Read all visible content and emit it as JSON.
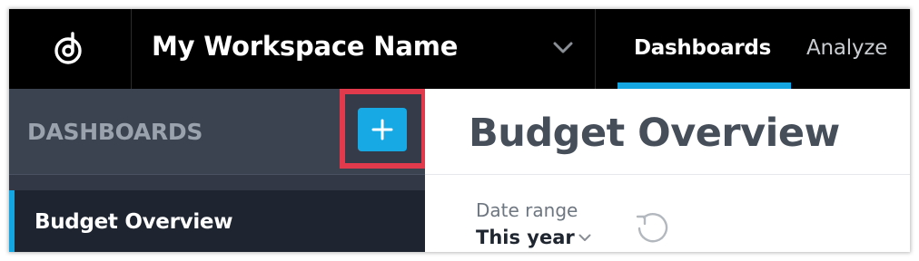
{
  "topbar": {
    "logo_icon": "product-logo-icon",
    "workspace_name": "My Workspace Name",
    "workspace_chevron_icon": "chevron-down-icon",
    "tabs": [
      {
        "label": "Dashboards",
        "active": true
      },
      {
        "label": "Analyze",
        "active": false
      }
    ]
  },
  "sidebar": {
    "title": "DASHBOARDS",
    "add_button_icon": "plus-icon",
    "items": [
      {
        "label": "Budget Overview",
        "active": true
      }
    ]
  },
  "main": {
    "title": "Budget Overview",
    "filters": {
      "date_range_label": "Date range",
      "date_range_value": "This year",
      "date_range_chevron_icon": "chevron-down-icon",
      "reset_icon": "reset-icon"
    }
  },
  "colors": {
    "topbar_bg": "#000000",
    "accent": "#13a6e0",
    "sidebar_bg": "#323846",
    "sidebar_header_bg": "#3b4250",
    "sidebar_item_active_bg": "#1e2430",
    "highlight": "#e23a4d"
  }
}
